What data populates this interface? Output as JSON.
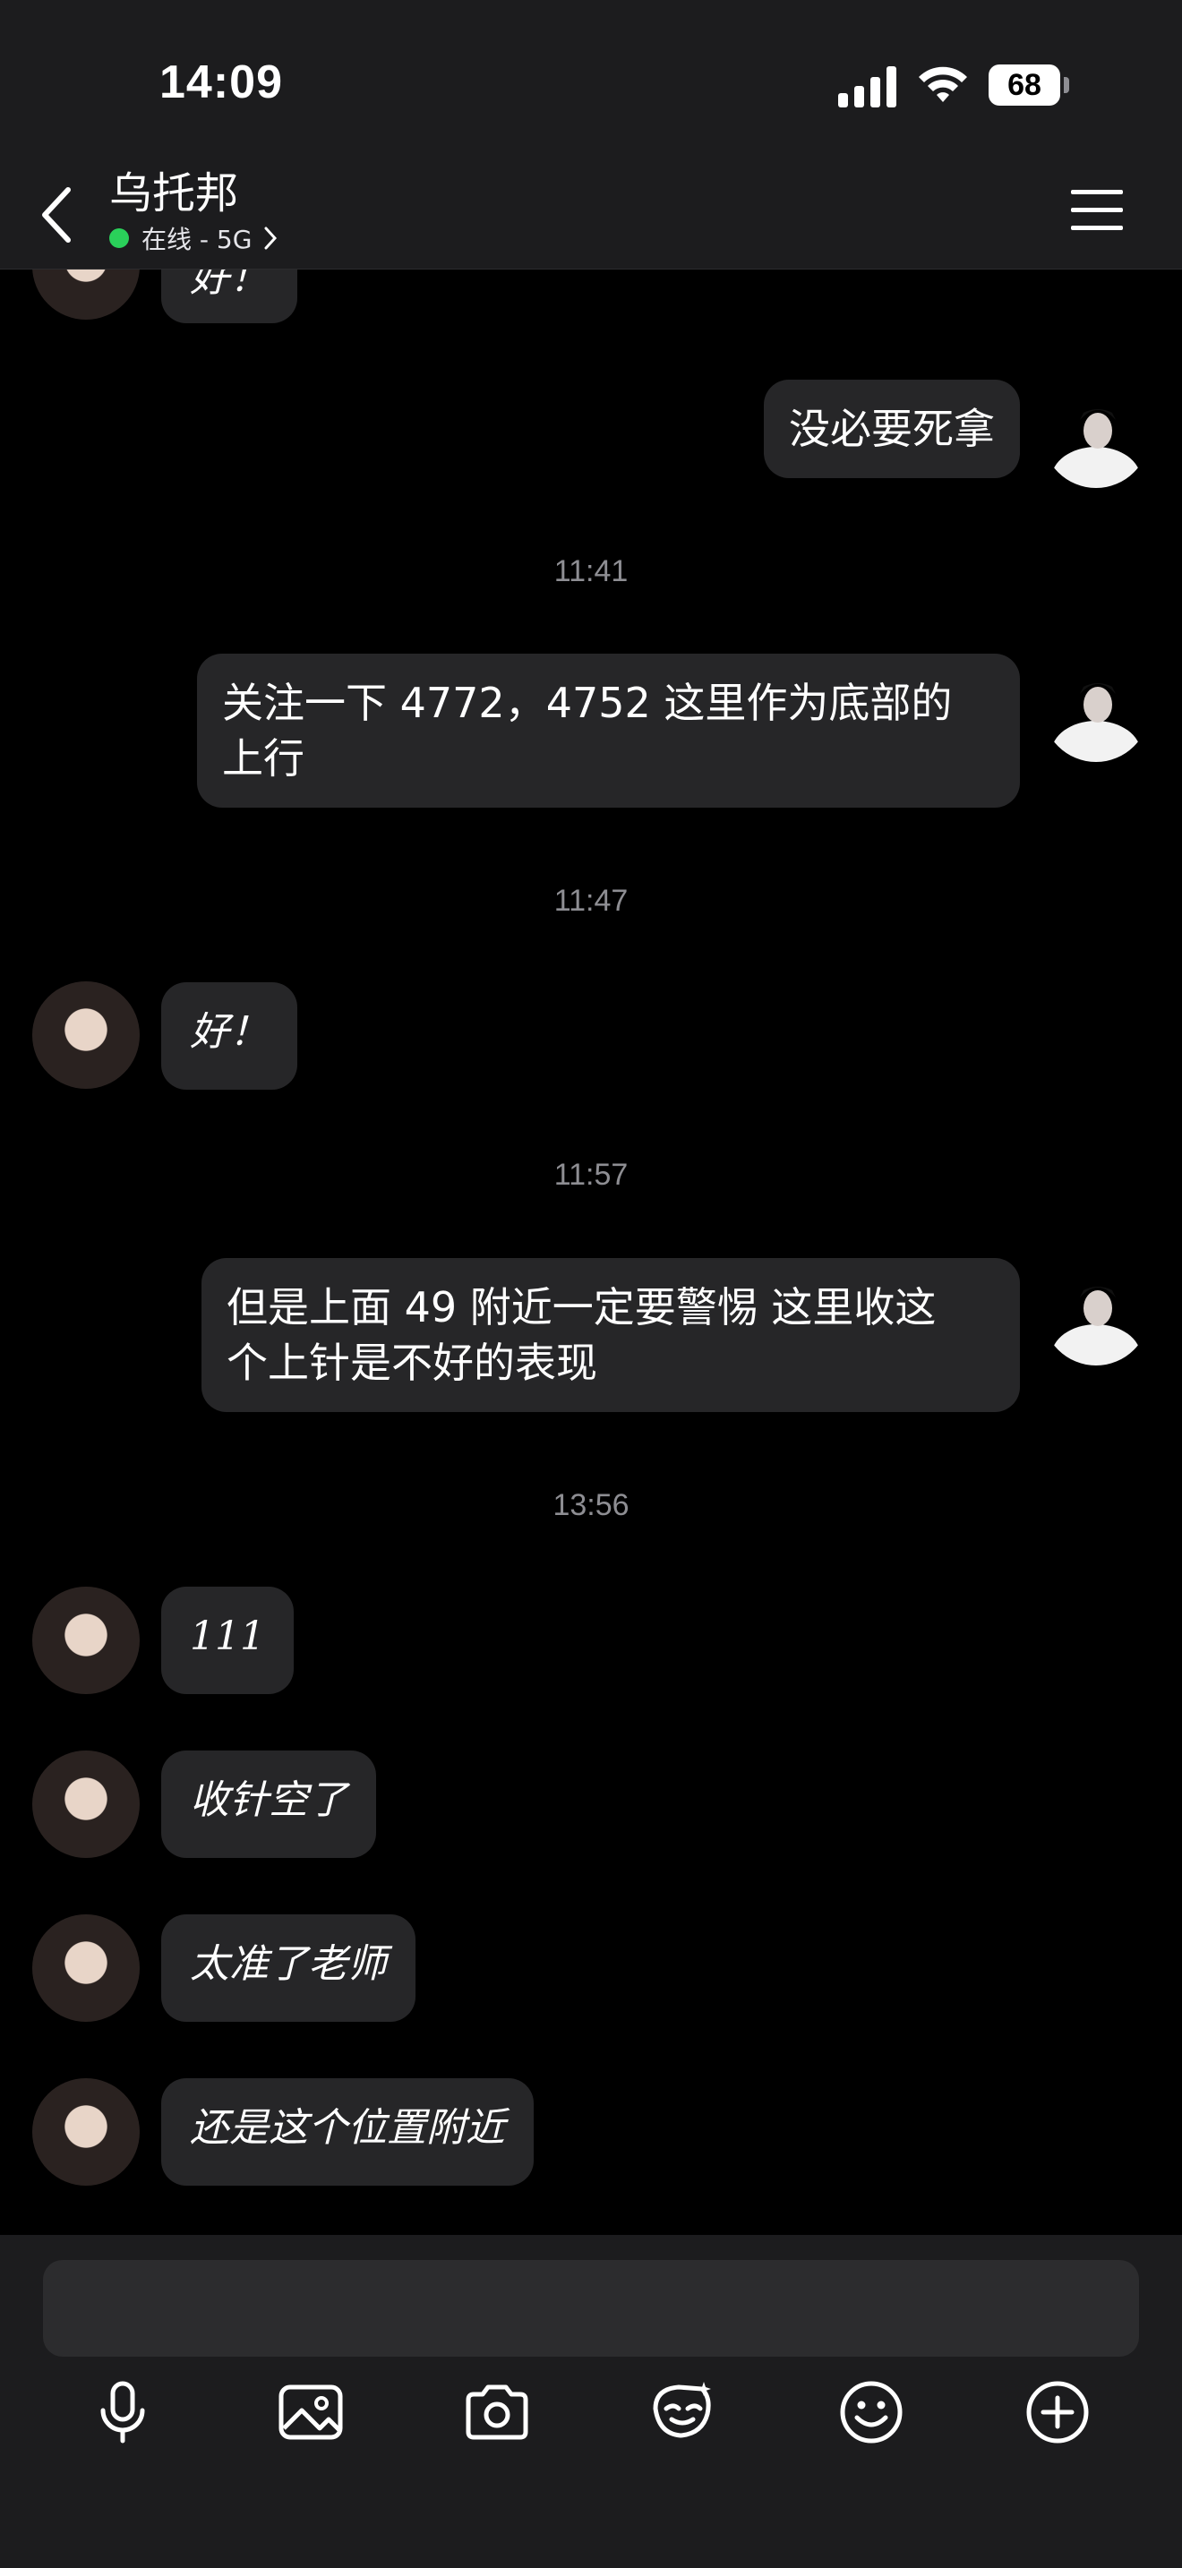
{
  "status_bar": {
    "time": "14:09",
    "battery": "68"
  },
  "header": {
    "title": "乌托邦",
    "status": "在线 - 5G"
  },
  "messages": [
    {
      "side": "in",
      "text": "好！"
    },
    {
      "side": "out",
      "text": "没必要死拿"
    },
    {
      "timestamp": "11:41"
    },
    {
      "side": "out",
      "text": "关注一下 4772，4752 这里作为底部的\n上行"
    },
    {
      "timestamp": "11:47"
    },
    {
      "side": "in",
      "text": "好！"
    },
    {
      "timestamp": "11:57"
    },
    {
      "side": "out",
      "text": "但是上面 49 附近一定要警惕 这里收这\n个上针是不好的表现"
    },
    {
      "timestamp": "13:56"
    },
    {
      "side": "in",
      "text": "111"
    },
    {
      "side": "in",
      "text": "收针空了"
    },
    {
      "side": "in",
      "text": "太准了老师"
    },
    {
      "side": "in",
      "text": "还是这个位置附近"
    }
  ],
  "composer": {
    "placeholder": "",
    "tools": [
      "microphone-icon",
      "image-icon",
      "camera-icon",
      "sticker-icon",
      "emoji-icon",
      "add-icon"
    ]
  },
  "colors": {
    "bubble": "#262628",
    "bar": "#1c1c1e",
    "online": "#2ad05a",
    "timestamp": "#8e8e93"
  }
}
